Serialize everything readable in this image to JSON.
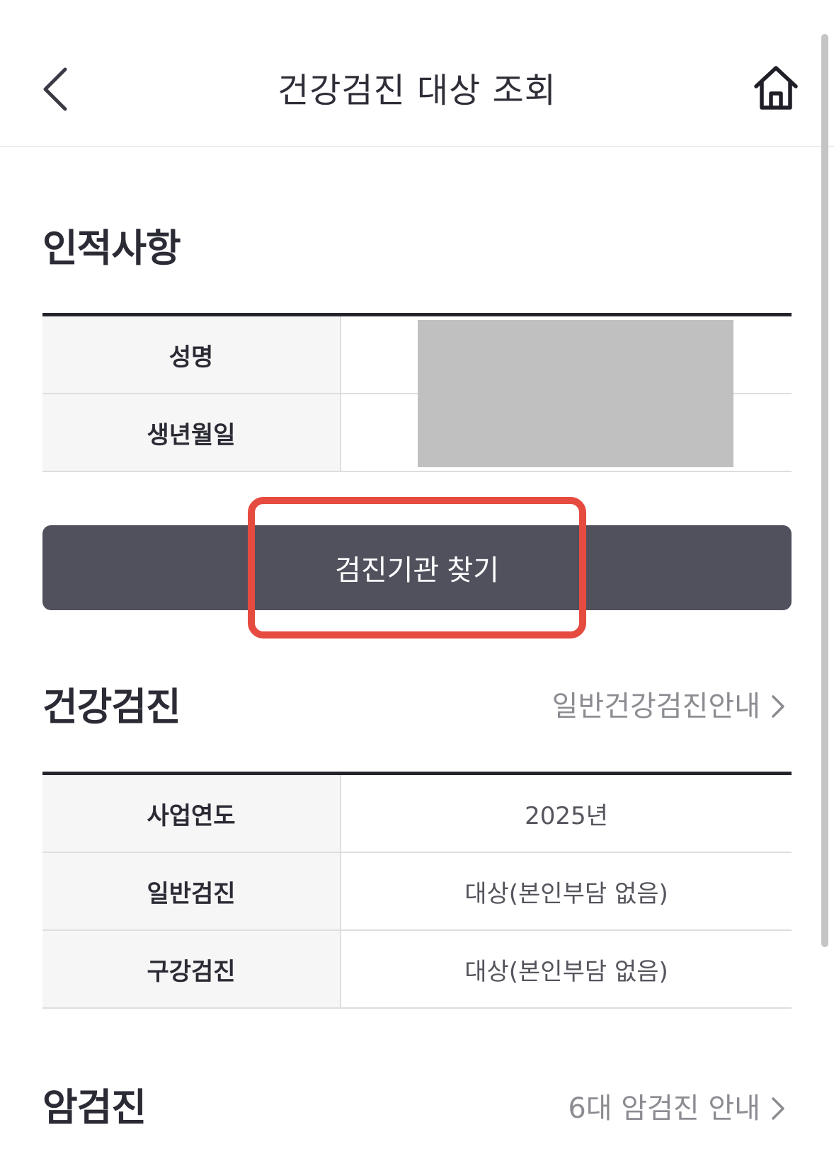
{
  "header": {
    "title": "건강검진 대상 조회",
    "back_icon": "chevron-left-icon",
    "home_icon": "home-icon"
  },
  "personal": {
    "title": "인적사항",
    "rows": [
      {
        "label": "성명",
        "value": ""
      },
      {
        "label": "생년월일",
        "value": ""
      }
    ]
  },
  "search_button": {
    "label": "검진기관 찾기"
  },
  "health_checkup": {
    "title": "건강검진",
    "guide_link": "일반건강검진안내",
    "rows": [
      {
        "label": "사업연도",
        "value": "2025년"
      },
      {
        "label": "일반검진",
        "value": "대상(본인부담 없음)"
      },
      {
        "label": "구강검진",
        "value": "대상(본인부담 없음)"
      }
    ]
  },
  "cancer_checkup": {
    "title": "암검진",
    "guide_link": "6대 암검진 안내"
  },
  "colors": {
    "button_bg": "#51515e",
    "highlight": "#e64b40",
    "table_header_bg": "#f6f6f6",
    "redaction": "#c0c0c0"
  }
}
